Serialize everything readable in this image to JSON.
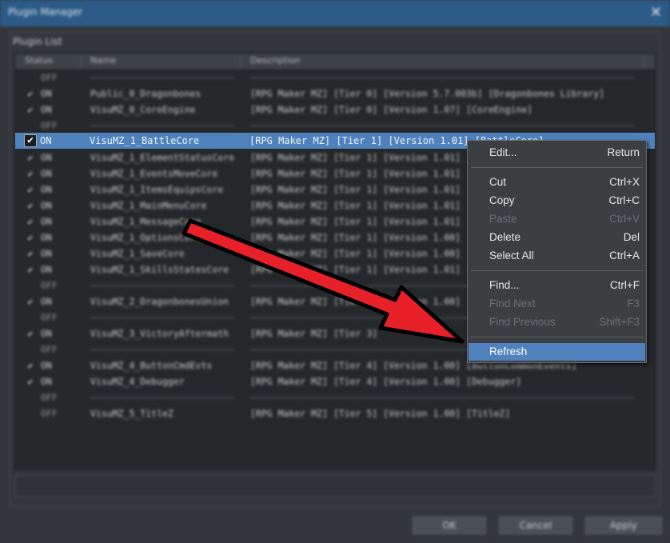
{
  "window": {
    "title": "Plugin Manager",
    "close_glyph": "✕"
  },
  "group_title": "Plugin List",
  "columns": {
    "status": "Status",
    "name": "Name",
    "description": "Description"
  },
  "rows": [
    {
      "type": "divider",
      "status": "OFF"
    },
    {
      "type": "plugin",
      "checked": true,
      "status": "ON",
      "name": "Public_0_Dragonbones",
      "description": "[RPG Maker MZ] [Tier 0] [Version 5.7.003b] [Dragonbones Library]"
    },
    {
      "type": "plugin",
      "checked": true,
      "status": "ON",
      "name": "VisuMZ_0_CoreEngine",
      "description": "[RPG Maker MZ] [Tier 0] [Version 1.07] [CoreEngine]"
    },
    {
      "type": "divider",
      "status": "OFF"
    },
    {
      "type": "selected",
      "checked": true,
      "status": "ON",
      "name": "VisuMZ_1_BattleCore",
      "description": "[RPG Maker MZ] [Tier 1] [Version 1.01] [BattleCore]"
    },
    {
      "type": "plugin",
      "checked": true,
      "status": "ON",
      "name": "VisuMZ_1_ElementStatusCore",
      "description": "[RPG Maker MZ] [Tier 1] [Version 1.01]"
    },
    {
      "type": "plugin",
      "checked": true,
      "status": "ON",
      "name": "VisuMZ_1_EventsMoveCore",
      "description": "[RPG Maker MZ] [Tier 1] [Version 1.01]"
    },
    {
      "type": "plugin",
      "checked": true,
      "status": "ON",
      "name": "VisuMZ_1_ItemsEquipsCore",
      "description": "[RPG Maker MZ] [Tier 1] [Version 1.01]"
    },
    {
      "type": "plugin",
      "checked": true,
      "status": "ON",
      "name": "VisuMZ_1_MainMenuCore",
      "description": "[RPG Maker MZ] [Tier 1] [Version 1.01]"
    },
    {
      "type": "plugin",
      "checked": true,
      "status": "ON",
      "name": "VisuMZ_1_MessageCore",
      "description": "[RPG Maker MZ] [Tier 1] [Version 1.01]"
    },
    {
      "type": "plugin",
      "checked": true,
      "status": "ON",
      "name": "VisuMZ_1_OptionsCore",
      "description": "[RPG Maker MZ] [Tier 1] [Version 1.00]"
    },
    {
      "type": "plugin",
      "checked": true,
      "status": "ON",
      "name": "VisuMZ_1_SaveCore",
      "description": "[RPG Maker MZ] [Tier 1] [Version 1.00]"
    },
    {
      "type": "plugin",
      "checked": true,
      "status": "ON",
      "name": "VisuMZ_1_SkillsStatesCore",
      "description": "[RPG Maker MZ] [Tier 1] [Version 1.01]"
    },
    {
      "type": "divider",
      "status": "OFF"
    },
    {
      "type": "plugin",
      "checked": true,
      "status": "ON",
      "name": "VisuMZ_2_DragonbonesUnion",
      "description": "[RPG Maker MZ] [Tier 2] [Version 1.00]"
    },
    {
      "type": "divider",
      "status": "OFF"
    },
    {
      "type": "plugin",
      "checked": true,
      "status": "ON",
      "name": "VisuMZ_3_VictoryAftermath",
      "description": "[RPG Maker MZ] [Tier 3]"
    },
    {
      "type": "divider",
      "status": "OFF"
    },
    {
      "type": "plugin",
      "checked": true,
      "status": "ON",
      "name": "VisuMZ_4_ButtonCmdEvts",
      "description": "[RPG Maker MZ] [Tier 4] [Version 1.00] [ButtonCommonEvents]"
    },
    {
      "type": "plugin",
      "checked": true,
      "status": "ON",
      "name": "VisuMZ_4_Debugger",
      "description": "[RPG Maker MZ] [Tier 4] [Version 1.00] [Debugger]"
    },
    {
      "type": "divider",
      "status": "OFF"
    },
    {
      "type": "plugin",
      "checked": false,
      "status": "OFF",
      "name": "VisuMZ_5_TitleZ",
      "description": "[RPG Maker MZ] [Tier 5] [Version 1.00] [TitleZ]"
    }
  ],
  "buttons": {
    "ok": "OK",
    "cancel": "Cancel",
    "apply": "Apply"
  },
  "context_menu": {
    "items": [
      {
        "label": "Edit...",
        "shortcut": "Return",
        "enabled": true
      },
      {
        "sep": true
      },
      {
        "label": "Cut",
        "shortcut": "Ctrl+X",
        "enabled": true
      },
      {
        "label": "Copy",
        "shortcut": "Ctrl+C",
        "enabled": true
      },
      {
        "label": "Paste",
        "shortcut": "Ctrl+V",
        "enabled": false
      },
      {
        "label": "Delete",
        "shortcut": "Del",
        "enabled": true
      },
      {
        "label": "Select All",
        "shortcut": "Ctrl+A",
        "enabled": true
      },
      {
        "sep": true
      },
      {
        "label": "Find...",
        "shortcut": "Ctrl+F",
        "enabled": true
      },
      {
        "label": "Find Next",
        "shortcut": "F3",
        "enabled": false
      },
      {
        "label": "Find Previous",
        "shortcut": "Shift+F3",
        "enabled": false
      },
      {
        "sep": true
      },
      {
        "label": "Refresh",
        "shortcut": "",
        "enabled": true,
        "highlighted": true
      }
    ]
  },
  "annotation": {
    "arrow_fill": "#e8202a",
    "arrow_outline": "#000000",
    "check_glyph": "✔"
  },
  "colors": {
    "selection": "#4f82bd",
    "titlebar": "#2c5a86",
    "menu_bg": "#3c3f42"
  }
}
